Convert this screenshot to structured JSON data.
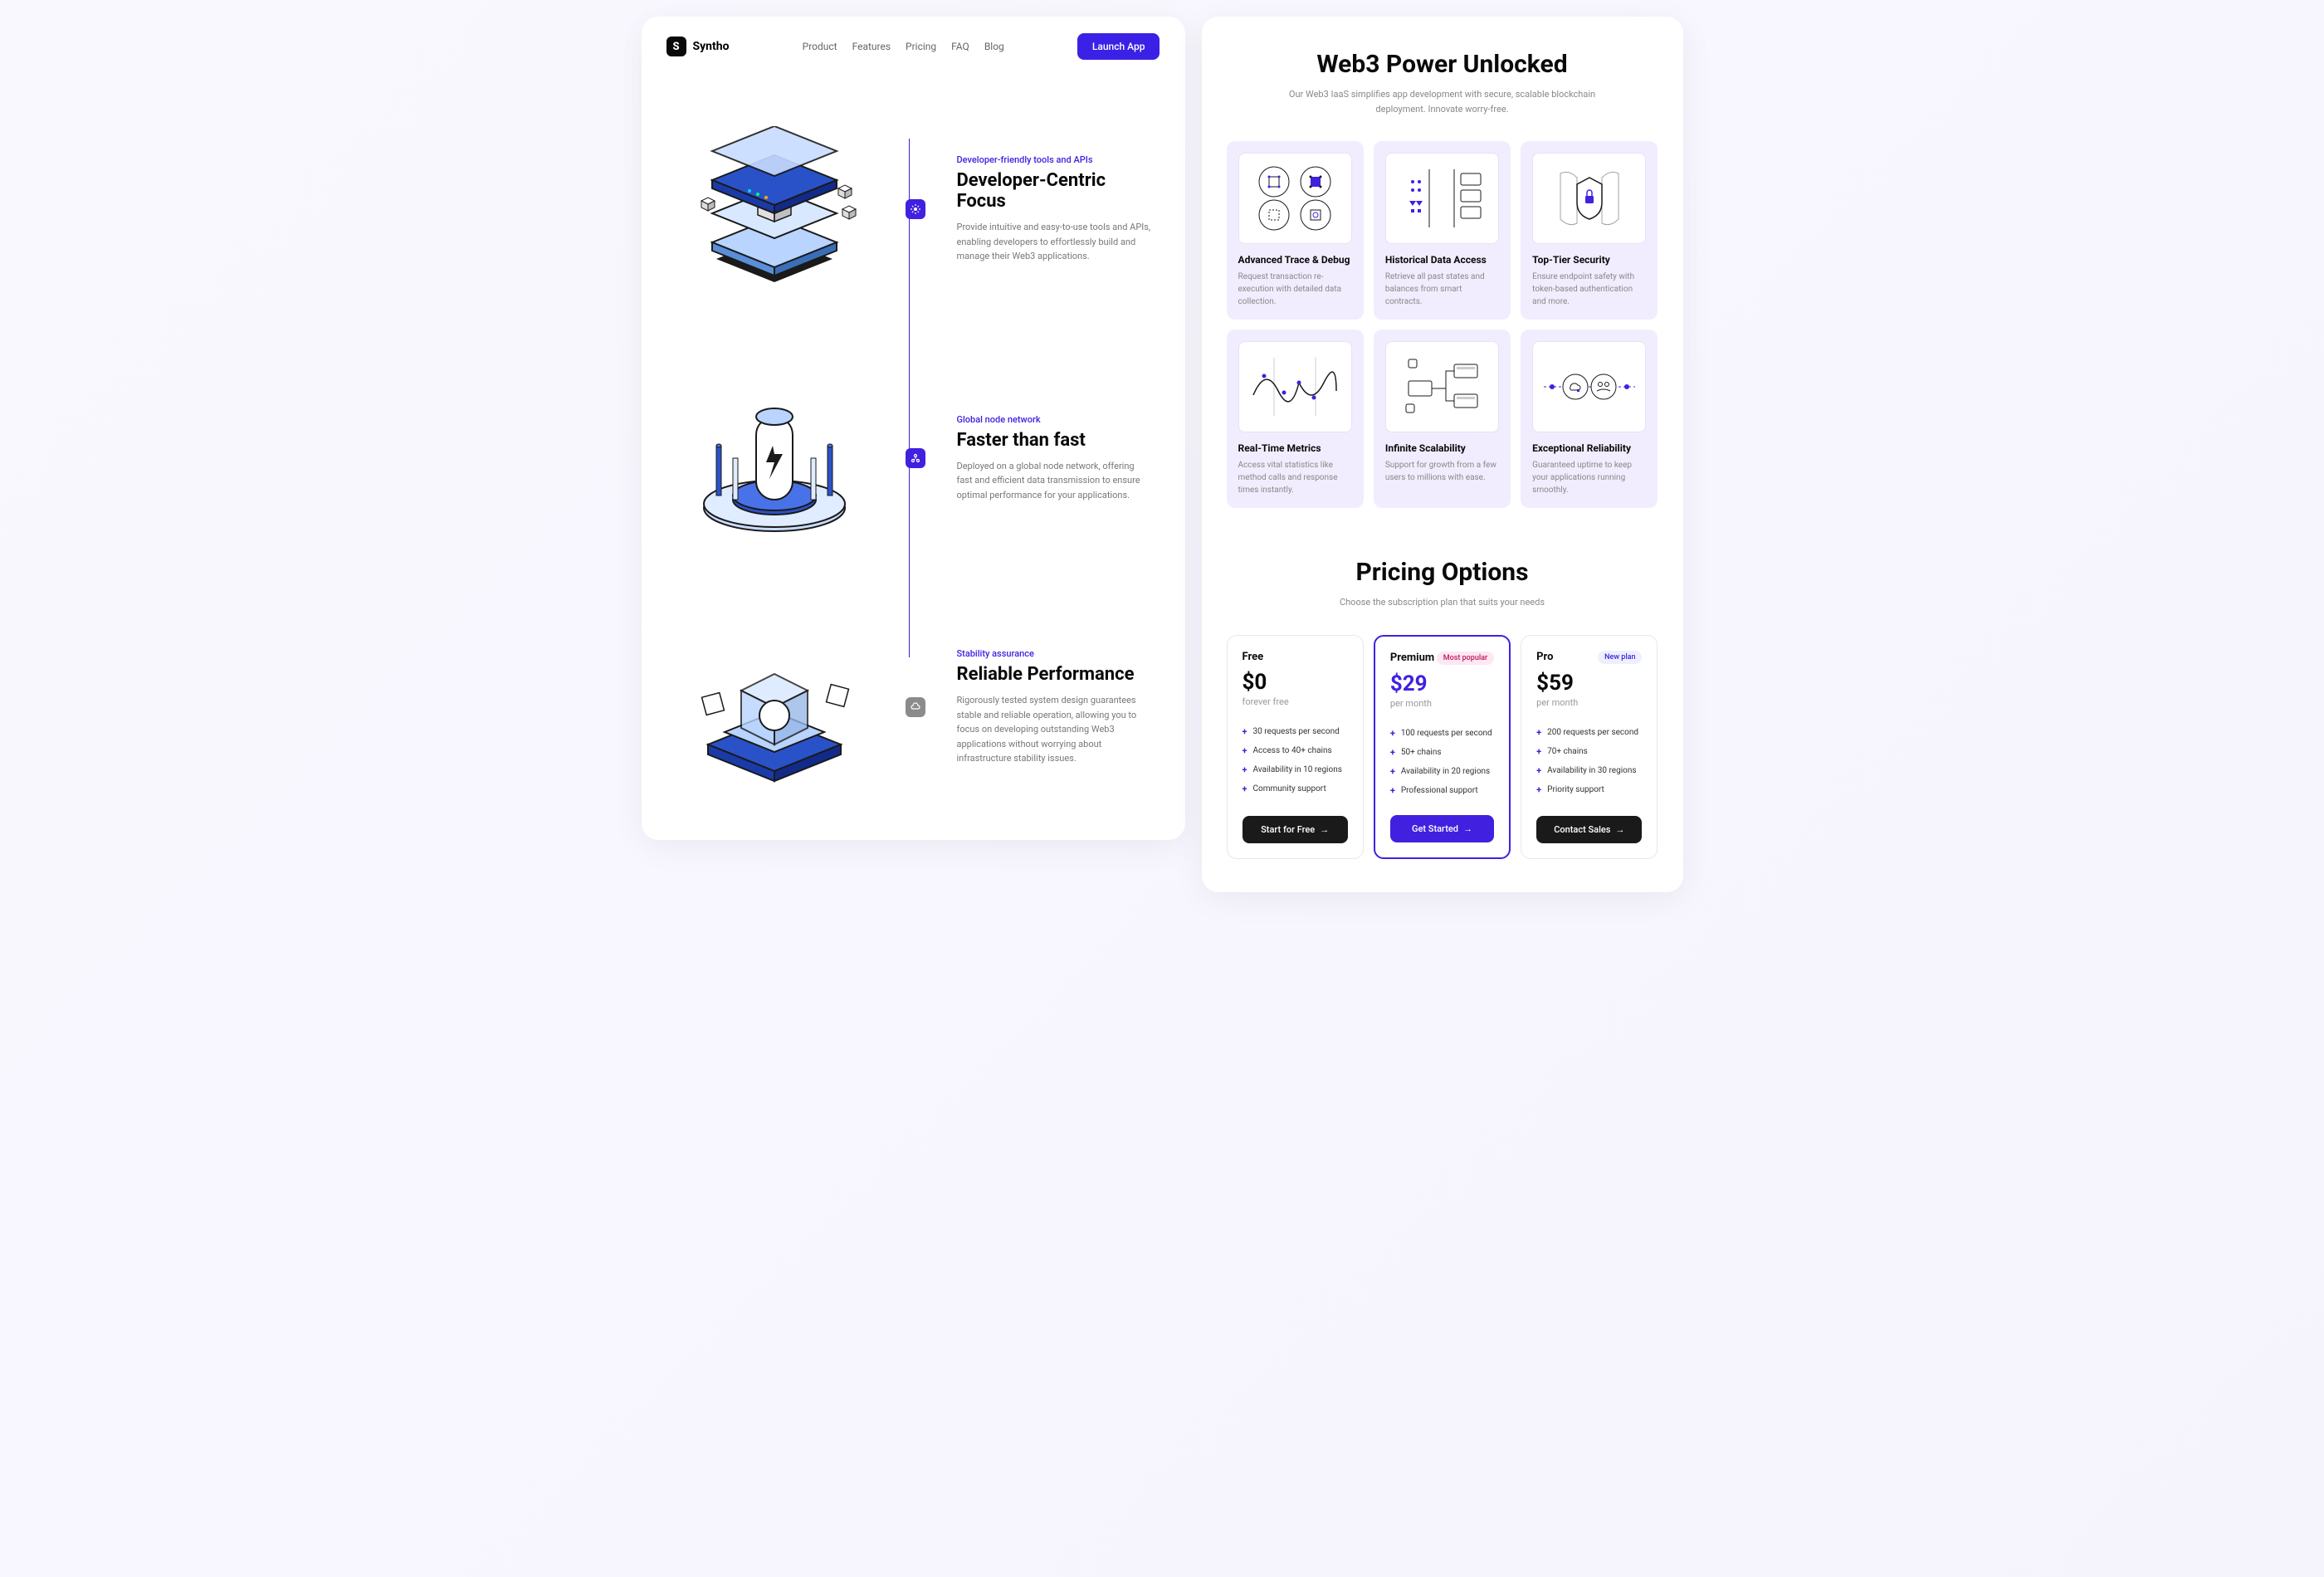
{
  "nav": {
    "brand": "Syntho",
    "links": [
      "Product",
      "Features",
      "Pricing",
      "FAQ",
      "Blog"
    ],
    "cta": "Launch App"
  },
  "features": [
    {
      "eyebrow": "Developer-friendly tools and APIs",
      "title": "Developer-Centric Focus",
      "desc": "Provide intuitive and easy-to-use tools and APIs, enabling developers to effortlessly build and manage their Web3 applications."
    },
    {
      "eyebrow": "Global node network",
      "title": "Faster than fast",
      "desc": "Deployed on a global node network, offering fast and efficient data transmission to ensure optimal performance for your applications."
    },
    {
      "eyebrow": "Stability assurance",
      "title": "Reliable Performance",
      "desc": "Rigorously tested system design guarantees stable and reliable operation, allowing you to focus on developing outstanding Web3 applications without worrying about infrastructure stability issues."
    }
  ],
  "power": {
    "title": "Web3 Power Unlocked",
    "sub": "Our Web3 IaaS simplifies app development with secure, scalable blockchain deployment. Innovate worry-free.",
    "cards": [
      {
        "title": "Advanced Trace & Debug",
        "desc": "Request transaction re-execution with detailed data collection."
      },
      {
        "title": "Historical Data Access",
        "desc": "Retrieve all past states and balances from smart contracts."
      },
      {
        "title": "Top-Tier Security",
        "desc": "Ensure endpoint safety with token-based authentication and more."
      },
      {
        "title": "Real-Time Metrics",
        "desc": "Access vital statistics like method calls and response times instantly."
      },
      {
        "title": "Infinite Scalability",
        "desc": "Support for growth from a few users to millions with ease."
      },
      {
        "title": "Exceptional Reliability",
        "desc": "Guaranteed uptime to keep your applications running smoothly."
      }
    ]
  },
  "pricing": {
    "title": "Pricing Options",
    "sub": "Choose the subscription plan that suits your needs",
    "plans": [
      {
        "name": "Free",
        "amount": "$0",
        "period": "forever free",
        "features": [
          "30 requests per second",
          "Access to 40+ chains",
          "Availability in 10 regions",
          "Community support"
        ],
        "cta": "Start for Free"
      },
      {
        "name": "Premium",
        "badge": "Most popular",
        "amount": "$29",
        "period": "per month",
        "features": [
          "100 requests per second",
          "50+ chains",
          "Availability in 20 regions",
          "Professional support"
        ],
        "cta": "Get Started"
      },
      {
        "name": "Pro",
        "badge": "New plan",
        "amount": "$59",
        "period": "per month",
        "features": [
          "200 requests per second",
          "70+ chains",
          "Availability in 30 regions",
          "Priority support"
        ],
        "cta": "Contact Sales"
      }
    ]
  }
}
